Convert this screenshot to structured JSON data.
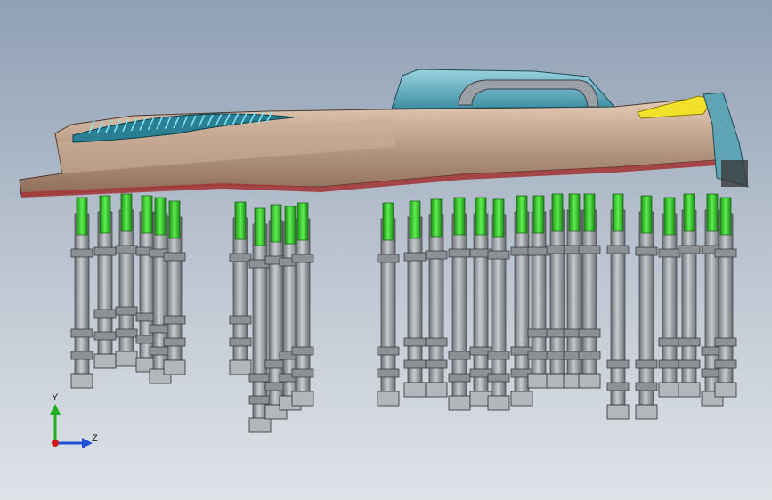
{
  "triad": {
    "y_label": "Y",
    "z_label": "Z",
    "y_color": "#20b020",
    "z_color": "#1f4fd8",
    "x_color": "#d01818"
  },
  "colors": {
    "background_top": "#8f9fb4",
    "background_bottom": "#dfe3e8",
    "panel": "#b99a84",
    "teal_part": "#5fb1c4",
    "clamp_green": "#34d12b",
    "post_gray": "#a9acb0",
    "edge_red": "#b13a3a",
    "yellow_tab": "#f1e12a"
  }
}
